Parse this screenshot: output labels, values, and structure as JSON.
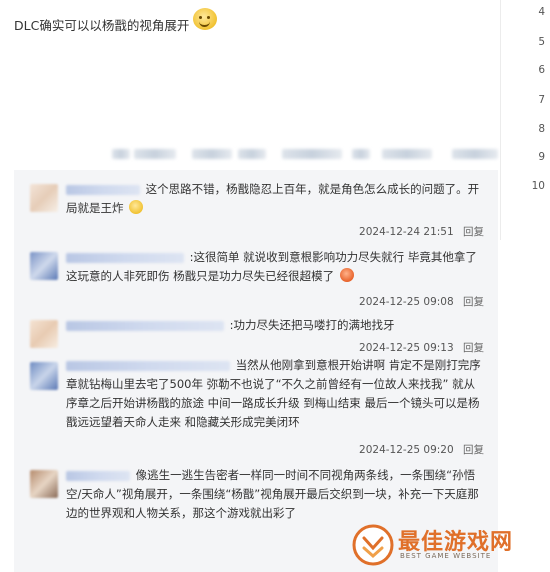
{
  "post": {
    "text": "DLC确实可以以杨戬的视角展开"
  },
  "floors": [
    "4",
    "5",
    "6",
    "7",
    "8",
    "9",
    "10"
  ],
  "replies": [
    {
      "text": "这个思路不错，杨戬隐忍上百年，就是角色怎么成长的问题了。开局就是王炸",
      "time": "2024-12-24 21:51",
      "emoji": "smile"
    },
    {
      "text": ":这很简单 就说收到意根影响功力尽失就行 毕竟其他拿了这玩意的人非死即伤 杨戬只是功力尽失已经很超模了",
      "time": "2024-12-25 09:08",
      "emoji": "angry"
    },
    {
      "text": ":功力尽失还把马喽打的满地找牙",
      "time": "2024-12-25 09:13"
    },
    {
      "text": "当然从他刚拿到意根开始讲啊 肯定不是刚打完序章就钻梅山里去宅了500年 弥勒不也说了“不久之前曾经有一位故人来找我” 就从序章之后开始讲杨戬的旅途 中间一路成长升级 到梅山结束 最后一个镜头可以是杨戬远远望着天命人走来 和隐藏关形成完美闭环",
      "time": "2024-12-25 09:20"
    },
    {
      "text": "像逃生一逃生告密者一样同一时间不同视角两条线，一条围绕“孙悟空/天命人”视角展开，一条围绕“杨戬”视角展开最后交织到一块，补充一下天庭那边的世界观和人物关系，那这个游戏就出彩了"
    }
  ],
  "reply_label": "回复",
  "watermark": {
    "title": "最佳游戏网",
    "subtitle": "BEST GAME WEBSITE"
  }
}
